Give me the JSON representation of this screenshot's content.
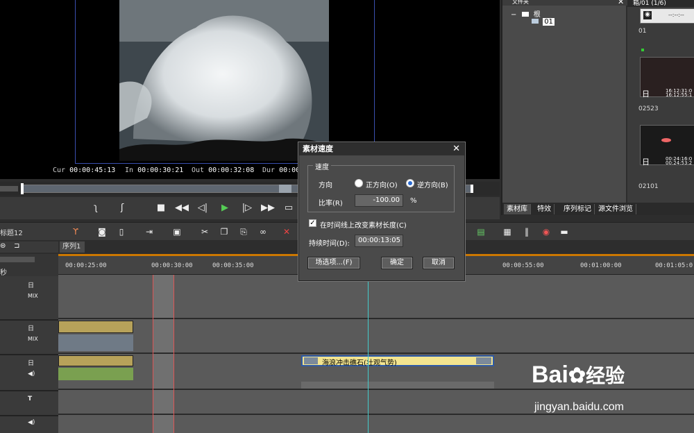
{
  "preview": {
    "cur_label": "Cur",
    "cur_value": "00:00:45:13",
    "in_label": "In",
    "in_value": "00:00:30:21",
    "out_label": "Out",
    "out_value": "00:00:32:08",
    "dur_label": "Dur",
    "dur_value": "00:00"
  },
  "folder_panel": {
    "title": "文件夹",
    "root_label": "根",
    "child_label": "01",
    "close_icon": "close-icon"
  },
  "bin_panel": {
    "title": "箱/01 (1/6)",
    "items": [
      {
        "label": "01",
        "ts": "--:--:--"
      },
      {
        "label": "02523",
        "ts1": "16:12:31:0",
        "ts2": "16:12:55:1"
      },
      {
        "label": "02101",
        "ts1": "00:24:16:0",
        "ts2": "00:24:53:2"
      }
    ]
  },
  "panel_tabs": [
    "素材库",
    "特效",
    "序列标记",
    "源文件浏览"
  ],
  "timeline": {
    "project_title": "标题12",
    "sequence_tab": "序列1",
    "unit_label": "秒",
    "ruler_ticks": [
      "00:00:25:00",
      "00:00:30:00",
      "00:00:35:00",
      "00:00:55:00",
      "00:01:00:00",
      "00:01:05:0"
    ],
    "mix_label": "MIX",
    "clip_title": "海浪冲击礁石(壮观气势)",
    "title_track": "T"
  },
  "dialog": {
    "title": "素材速度",
    "group_label": "速度",
    "direction_label": "方向",
    "forward_label": "正方向(O)",
    "reverse_label": "逆方向(B)",
    "rate_label": "比率(R)",
    "rate_value": "-100.00",
    "rate_unit": "%",
    "checkbox_label": "在时间线上改变素材长度(C)",
    "duration_label": "持续时间(D):",
    "duration_value": "00:00:13:05",
    "field_options_label": "场选项...(F)",
    "ok_label": "确定",
    "cancel_label": "取消"
  },
  "watermark": {
    "brand": "Bai",
    "brand_suffix": "经验",
    "url": "jingyan.baidu.com"
  }
}
